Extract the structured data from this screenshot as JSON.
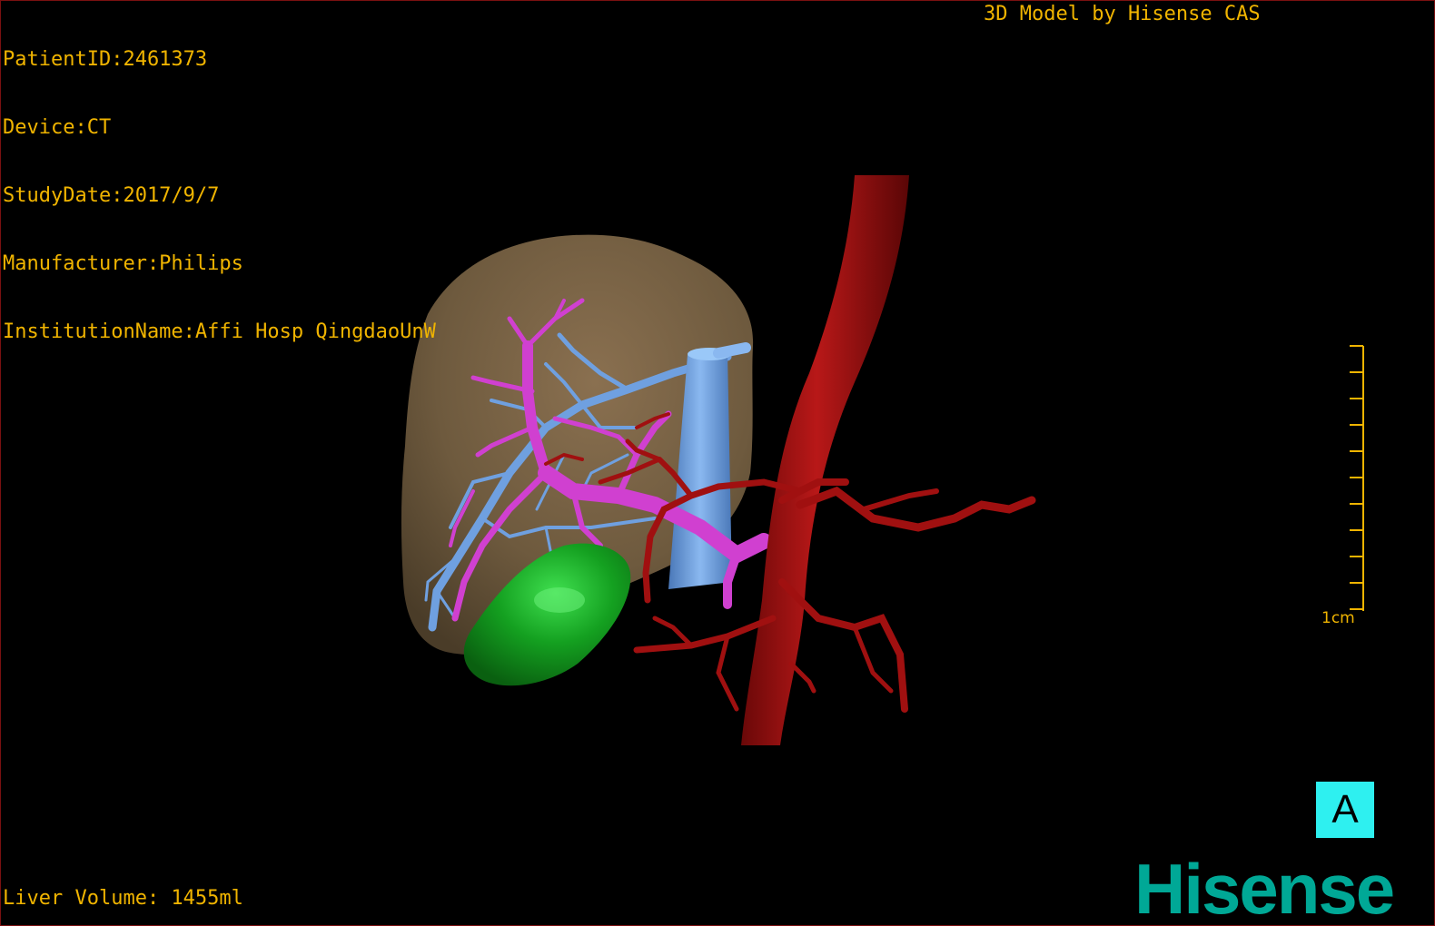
{
  "overlay": {
    "patient_id": "PatientID:2461373",
    "device": "Device:CT",
    "study_date": "StudyDate:2017/9/7",
    "manufacturer": "Manufacturer:Philips",
    "institution": "InstitutionName:Affi Hosp QingdaoUnW",
    "credit": "3D Model by Hisense CAS",
    "liver_volume": "Liver Volume: 1455ml"
  },
  "scale_bar": {
    "label": "1cm"
  },
  "orientation_marker": {
    "label": "A"
  },
  "brand": {
    "logo_text": "Hisense"
  },
  "colors": {
    "overlay_text": "#f0b400",
    "liver": "#7a6446",
    "hepatic_vein": "#6fa0e0",
    "portal_vein": "#d040d0",
    "artery": "#a01010",
    "gallbladder": "#10a020",
    "orientation_box": "#2ef0f0",
    "brand": "#00a896"
  }
}
